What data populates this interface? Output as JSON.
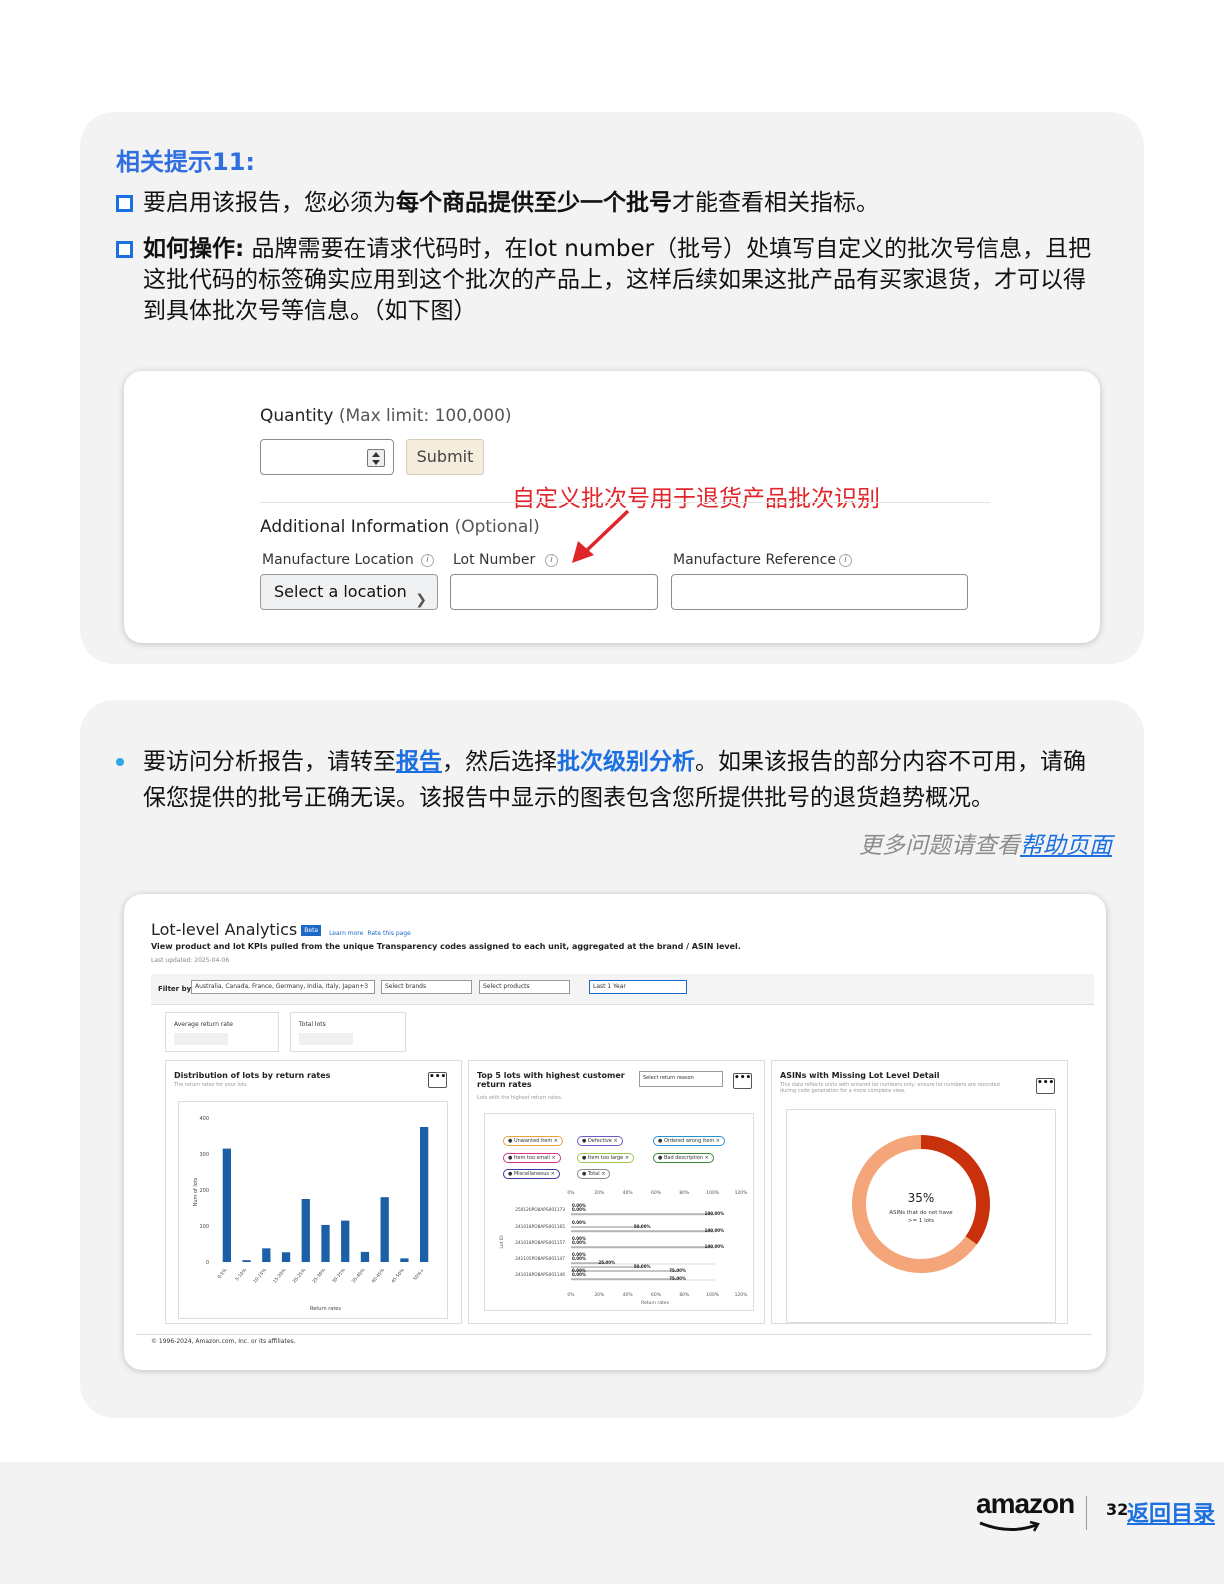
{
  "card1": {
    "title": "相关提示11:",
    "bullet1": {
      "pre": "要启用该报告，您必须为",
      "bold": "每个商品提供至少一个批号",
      "post": "才能查看相关指标。"
    },
    "bullet2": {
      "bold": "如何操作:",
      "text": " 品牌需要在请求代码时，在lot number（批号）处填写自定义的批次号信息，且把这批代码的标签确实应用到这个批次的产品上，这样后续如果这批产品有买家退货，才可以得到具体批次号等信息。（如下图）"
    },
    "form": {
      "quantity_label": "Quantity",
      "quantity_hint": "(Max limit: 100,000)",
      "submit_label": "Submit",
      "annotation": "自定义批次号用于退货产品批次识别",
      "additional_label": "Additional Information",
      "additional_hint": "(Optional)",
      "manufacture_location_label": "Manufacture Location",
      "lot_number_label": "Lot Number",
      "manufacture_reference_label": "Manufacture Reference",
      "select_location": "Select a location",
      "info_icon": "i"
    }
  },
  "card2": {
    "bullet": {
      "pre": "要访问分析报告，请转至",
      "link1": "报告",
      "mid": "，然后选择",
      "link2": "批次级别分析",
      "post": "。如果该报告的部分内容不可用，请确保您提供的批号正确无误。该报告中显示的图表包含您所提供批号的退货趋势概况。"
    },
    "more_help_pre": "更多问题请查看",
    "more_help_link": "帮助页面",
    "analytics": {
      "title": "Lot-level Analytics",
      "beta": "Beta",
      "learn_more": "Learn more",
      "rate_page": "Rate this page",
      "subtitle": "View product and lot KPIs pulled from the unique Transparency codes assigned to each unit, aggregated at the brand / ASIN level.",
      "last_updated": "Last updated: 2025-04-06",
      "filter_label": "Filter by",
      "filter_marketplaces": "Australia, Canada, France, Germany, India, Italy, Japan+3",
      "filter_brands": "Select brands",
      "filter_products": "Select products",
      "filter_period": "Last 1 Year",
      "kpi_avg_return": "Average return rate",
      "kpi_total_lots": "Total lots",
      "menu_dots": "•••",
      "info_glyph": "ⓘ",
      "panel1_title": "Distribution of lots by return rates",
      "panel1_sub": "The return rates for your lots.",
      "panel2_title": "Top 5 lots with highest customer return rates",
      "panel2_sub": "Lots with the highest return rates.",
      "panel2_select": "Select return reason",
      "panel3_title": "ASINs with Missing Lot Level Detail",
      "panel3_sub": "This data reflects units with entered lot numbers only; ensure lot numbers are recorded during code generation for a more complete view.",
      "donut_pct": "35%",
      "donut_label1": "ASINs that do not have",
      "donut_label2": ">= 1 lots",
      "copyright": "© 1996-2024, Amazon.com, Inc. or its affiliates."
    }
  },
  "footer": {
    "logo": "amazon",
    "page": "32",
    "toc": "返回目录"
  },
  "chart_data": [
    {
      "type": "bar",
      "title": "Distribution of lots by return rates",
      "xlabel": "Return rates",
      "ylabel": "Num of lots",
      "ylim": [
        0,
        400
      ],
      "yticks": [
        0,
        100,
        200,
        300,
        400
      ],
      "categories": [
        "0-5%",
        "5-10%",
        "10-15%",
        "15-20%",
        "20-25%",
        "25-30%",
        "30-35%",
        "35-40%",
        "40-45%",
        "45-50%",
        "50%+"
      ],
      "values": [
        315,
        5,
        38,
        27,
        175,
        103,
        115,
        28,
        180,
        10,
        375
      ],
      "color": "#1b5fa6"
    },
    {
      "type": "bar",
      "title": "Top 5 lots with highest customer return rates",
      "xlabel": "Return rates",
      "ylabel": "Lot ID",
      "xticks": [
        "0%",
        "20%",
        "40%",
        "60%",
        "80%",
        "100%",
        "120%"
      ],
      "legend": [
        "Unwanted item",
        "Defective",
        "Ordered wrong item",
        "Item too small",
        "Item too large",
        "Bad description",
        "Miscellaneous",
        "Total"
      ],
      "legend_colors": [
        "#e8a33a",
        "#6a5acd",
        "#2b8fd6",
        "#d63384",
        "#9ec64a",
        "#3a8a3a",
        "#3a3aa0",
        "#888888"
      ],
      "categories": [
        "250120PO8APS001173",
        "241018PO8APS001165",
        "241018PO8APS001157",
        "241105PO8APS001147",
        "241018PO8APS001146"
      ],
      "bar_labels": [
        [
          "0.00%",
          "0.00%",
          "100.00%"
        ],
        [
          "0.00%",
          "50.00%",
          "100.00%"
        ],
        [
          "0.00%",
          "0.00%",
          "100.00%"
        ],
        [
          "0.00%",
          "0.00%",
          "25.00%",
          "50.00%",
          "75.00%"
        ],
        [
          "0.00%",
          "0.00%",
          "75.00%"
        ]
      ]
    },
    {
      "type": "pie",
      "title": "ASINs with Missing Lot Level Detail",
      "values": [
        35,
        65
      ],
      "labels": [
        "ASINs that do not have >= 1 lots",
        ""
      ],
      "colors": [
        "#c9310c",
        "#f4a57a"
      ]
    }
  ]
}
